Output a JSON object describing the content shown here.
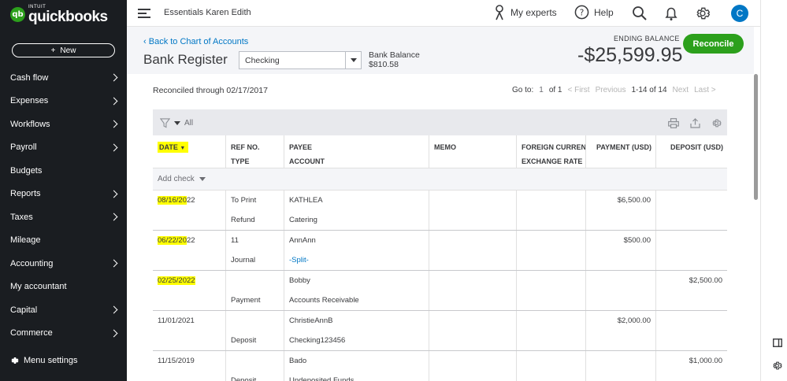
{
  "brand": {
    "intuit": "INTUIT",
    "name": "quickbooks",
    "badge": "qb"
  },
  "sidebar": {
    "new_label": "New",
    "items": [
      {
        "label": "Cash flow",
        "chevron": true
      },
      {
        "label": "Expenses",
        "chevron": true
      },
      {
        "label": "Workflows",
        "chevron": true
      },
      {
        "label": "Payroll",
        "chevron": true
      },
      {
        "label": "Budgets",
        "chevron": false
      },
      {
        "label": "Reports",
        "chevron": true
      },
      {
        "label": "Taxes",
        "chevron": true
      },
      {
        "label": "Mileage",
        "chevron": false
      },
      {
        "label": "Accounting",
        "chevron": true
      },
      {
        "label": "My accountant",
        "chevron": false
      },
      {
        "label": "Capital",
        "chevron": true
      },
      {
        "label": "Commerce",
        "chevron": true
      }
    ],
    "menu_settings": "Menu settings"
  },
  "topbar": {
    "company": "Essentials Karen Edith",
    "my_experts": "My experts",
    "help": "Help",
    "avatar_letter": "C"
  },
  "header": {
    "back_link": "Back to Chart of Accounts",
    "title": "Bank Register",
    "account_selected": "Checking",
    "bank_balance_label": "Bank Balance",
    "bank_balance_value": "$810.58",
    "ending_balance_label": "ENDING BALANCE",
    "ending_balance_value": "-$25,599.95",
    "reconcile_label": "Reconcile"
  },
  "register": {
    "reconciled_through": "Reconciled through 02/17/2017",
    "pager": {
      "goto": "Go to:",
      "page": "1",
      "of": "of 1",
      "first": "< First",
      "previous": "Previous",
      "range": "1-14 of 14",
      "next": "Next",
      "last": "Last >"
    },
    "filter_label": "All",
    "columns": {
      "date": "DATE",
      "ref_no": "REF NO.",
      "type": "TYPE",
      "payee": "PAYEE",
      "account": "ACCOUNT",
      "memo": "MEMO",
      "foreign_currency": "FOREIGN CURRENCY",
      "exchange_rate": "EXCHANGE RATE",
      "payment": "PAYMENT (USD)",
      "deposit": "DEPOSIT (USD)"
    },
    "add_check": "Add check",
    "rows": [
      {
        "date_hl": "08/16/20",
        "date_rest": "22",
        "ref": "To Print",
        "type": "Refund",
        "payee": "KATHLEA",
        "account": "Catering",
        "account_link": false,
        "payment": "$6,500.00",
        "deposit": ""
      },
      {
        "date_hl": "06/22/20",
        "date_rest": "22",
        "ref": "11",
        "type": "Journal",
        "payee": "AnnAnn",
        "account": "-Split-",
        "account_link": true,
        "payment": "$500.00",
        "deposit": ""
      },
      {
        "date_hl": "02/25/2022",
        "date_rest": "",
        "ref": "",
        "type": "Payment",
        "payee": "Bobby",
        "account": "Accounts Receivable",
        "account_link": false,
        "payment": "",
        "deposit": "$2,500.00"
      },
      {
        "date_hl": "",
        "date_rest": "11/01/2021",
        "ref": "",
        "type": "Deposit",
        "payee": "ChristieAnnB",
        "account": "Checking123456",
        "account_link": false,
        "payment": "$2,000.00",
        "deposit": ""
      },
      {
        "date_hl": "",
        "date_rest": "11/15/2019",
        "ref": "",
        "type": "Deposit",
        "payee": "Bado",
        "account": "Undeposited Funds",
        "account_link": false,
        "payment": "",
        "deposit": "$1,000.00"
      }
    ]
  }
}
